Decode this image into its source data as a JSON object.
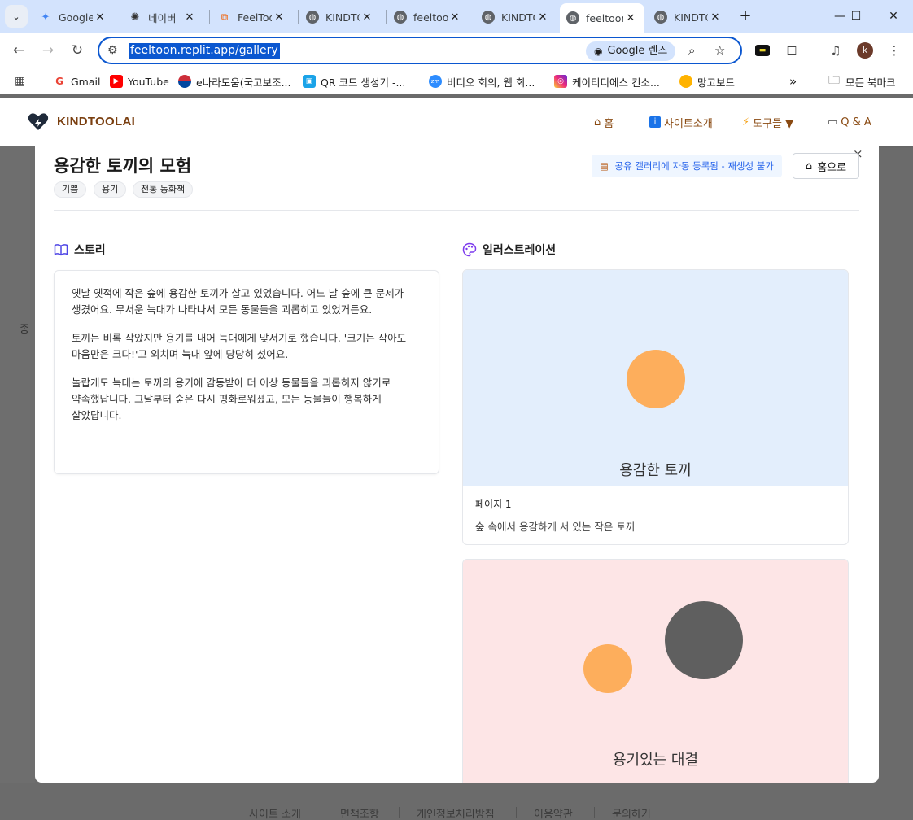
{
  "browser": {
    "tabs": [
      {
        "title": "Google",
        "icon": "gemini-icon",
        "active": false
      },
      {
        "title": "네이버",
        "icon": "openai-icon",
        "active": false
      },
      {
        "title": "FeelToon",
        "icon": "replit-icon",
        "active": false
      },
      {
        "title": "KINDTOOL",
        "icon": "globe-icon",
        "active": false
      },
      {
        "title": "feeltoon",
        "icon": "globe-icon",
        "active": false
      },
      {
        "title": "KINDTOOL",
        "icon": "globe-icon",
        "active": false
      },
      {
        "title": "feeltoon",
        "icon": "globe-icon",
        "active": true
      },
      {
        "title": "KINDTOOL",
        "icon": "globe-icon",
        "active": false
      }
    ],
    "url": "feeltoon.replit.app/gallery",
    "lens_label": "Google 렌즈",
    "profile_initial": "k",
    "bookmarks": [
      {
        "label": "Gmail",
        "icon": "gmail-icon"
      },
      {
        "label": "YouTube",
        "icon": "youtube-icon"
      },
      {
        "label": "e나라도움(국고보조...",
        "icon": "korea-gov-icon"
      },
      {
        "label": "QR 코드 생성기 -...",
        "icon": "qr-icon"
      },
      {
        "label": "비디오 회의, 웹 회...",
        "icon": "zoom-icon"
      },
      {
        "label": "케이티디에스 컨소...",
        "icon": "instagram-icon"
      },
      {
        "label": "망고보드",
        "icon": "mango-icon"
      }
    ],
    "all_bookmarks_label": "모든 북마크"
  },
  "site": {
    "brand": "KINDTOOLAI",
    "nav": [
      {
        "label": "홈",
        "icon": "home-icon"
      },
      {
        "label": "사이트소개",
        "icon": "info-icon"
      },
      {
        "label": "도구들 ▼",
        "icon": "lightning-icon"
      },
      {
        "label": "Q & A",
        "icon": "chat-icon"
      }
    ],
    "footer_links": [
      "사이트 소개",
      "면책조항",
      "개인정보처리방침",
      "이용약관",
      "문의하기"
    ],
    "stray_text": "종"
  },
  "modal": {
    "close_label": "×",
    "title": "용감한 토끼의 모험",
    "tags": [
      "기쁨",
      "용기",
      "전통 동화책"
    ],
    "share_note": "공유 갤러리에 자동 등록됨 - 재생성 불가",
    "home_button": "홈으로",
    "story_heading": "스토리",
    "illustration_heading": "일러스트레이션",
    "story_paragraphs": [
      "옛날 옛적에 작은 숲에 용감한 토끼가 살고 있었습니다. 어느 날 숲에 큰 문제가 생겼어요. 무서운 늑대가 나타나서 모든 동물들을 괴롭히고 있었거든요.",
      "토끼는 비록 작았지만 용기를 내어 늑대에게 맞서기로 했습니다. '크기는 작아도 마음만은 크다!'고 외치며 늑대 앞에 당당히 섰어요.",
      "놀랍게도 늑대는 토끼의 용기에 감동받아 더 이상 동물들을 괴롭히지 않기로 약속했답니다. 그날부터 숲은 다시 평화로워졌고, 모든 동물들이 행복하게 살았답니다."
    ],
    "illustrations": [
      {
        "caption": "용감한 토끼",
        "page": "페이지 1",
        "description": "숲 속에서 용감하게 서 있는 작은 토끼",
        "bg_color": "#e3eefc"
      },
      {
        "caption": "용기있는 대결",
        "page": "",
        "description": "",
        "bg_color": "#fde5e6"
      }
    ],
    "colors": {
      "orange": "#fdae5c",
      "gray": "#5f5f5f",
      "accent": "#2563eb",
      "brand": "#7a3f10"
    }
  }
}
